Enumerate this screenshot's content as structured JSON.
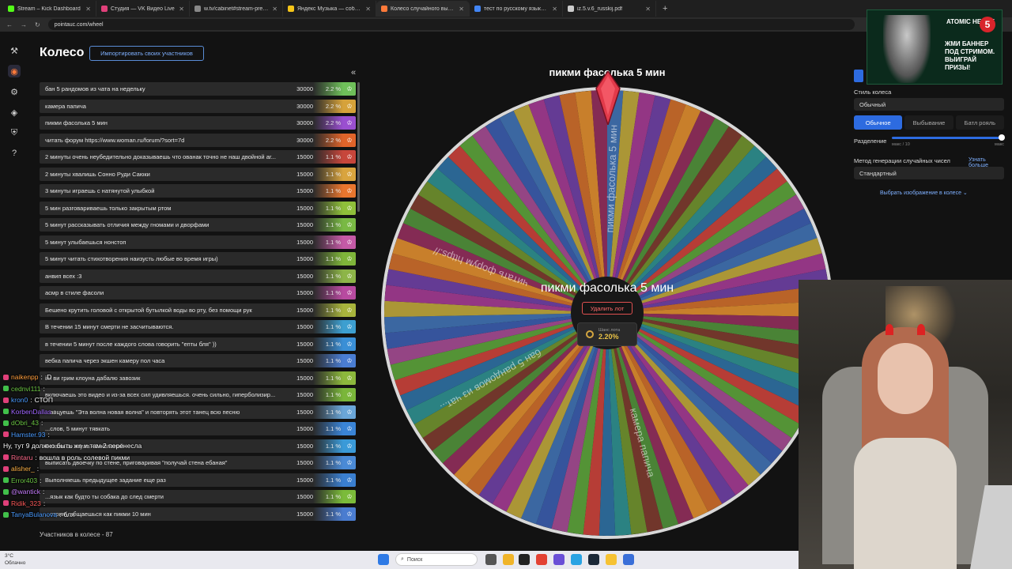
{
  "browser": {
    "tabs": [
      {
        "title": "Stream – Kick Dashboard",
        "color": "#53fc18"
      },
      {
        "title": "Студия — VK Видео Live",
        "color": "#e0407a"
      },
      {
        "title": "w.tv/cabinet#stream-preview",
        "color": "#888888"
      },
      {
        "title": "Яндекс Музыка — собираем музыку",
        "color": "#f5c518"
      },
      {
        "title": "Колесо случайного выбора",
        "color": "#ff7a3a"
      },
      {
        "title": "тест по русскому языку за 5 класс",
        "color": "#4285f4"
      },
      {
        "title": "iz.5.v.6_russkij.pdf",
        "color": "#cccccc"
      }
    ],
    "active_tab": 4,
    "new_tab": "+",
    "url": "pointauc.com/wheel"
  },
  "rail": {
    "icons": [
      "hammer-icon",
      "wheel-icon",
      "gear-icon",
      "layers-icon",
      "shield-icon",
      "help-icon"
    ],
    "glyphs": [
      "⚒",
      "◉",
      "⚙",
      "◈",
      "⛨",
      "?"
    ]
  },
  "header": {
    "title": "Колесо",
    "import_label": "Импортировать своих участников",
    "collapse": "«"
  },
  "lots": [
    {
      "name": "бан 5 рандомов из чата на недельку",
      "amount": "30000",
      "pct": "2.2 %",
      "color": "#6fbf5a"
    },
    {
      "name": "камера папича",
      "amount": "30000",
      "pct": "2.2 %",
      "color": "#d6a23a"
    },
    {
      "name": "пикми фасолька 5 мин",
      "amount": "30000",
      "pct": "2.2 %",
      "color": "#9a4fd0"
    },
    {
      "name": "читать форум https://www.woman.ru/forum/?sort=7d",
      "amount": "30000",
      "pct": "2.2 %",
      "color": "#e0642a"
    },
    {
      "name": "2 минуты очень неубедительно доказываешь что ованак точно не наш двойной аг...",
      "amount": "15000",
      "pct": "1.1 %",
      "color": "#c7463b"
    },
    {
      "name": "2 минуты хвалишь Сонно Руди Саюки",
      "amount": "15000",
      "pct": "1.1 %",
      "color": "#d9a43e"
    },
    {
      "name": "3 минуты играешь с натянутой улыбкой",
      "amount": "15000",
      "pct": "1.1 %",
      "color": "#e8762e"
    },
    {
      "name": "5 мин разговариваешь только закрытым ртом",
      "amount": "15000",
      "pct": "1.1 %",
      "color": "#8fbf3a"
    },
    {
      "name": "5 минут рассказывать отличия между гномами и дворфами",
      "amount": "15000",
      "pct": "1.1 %",
      "color": "#79b944"
    },
    {
      "name": "5 минут улыбаешься нонстоп",
      "amount": "15000",
      "pct": "1.1 %",
      "color": "#c55aa6"
    },
    {
      "name": "5 минут читать стихотворения наизусть любые во время игры)",
      "amount": "15000",
      "pct": "1.1 %",
      "color": "#7fb53a"
    },
    {
      "name": "анвип всех :3",
      "amount": "15000",
      "pct": "1.1 %",
      "color": "#8db548"
    },
    {
      "name": "асмр в стиле фасоли",
      "amount": "15000",
      "pct": "1.1 %",
      "color": "#b84aa0"
    },
    {
      "name": "Бешено крутить головой с открытой бутылкой воды во рту, без помощи рук",
      "amount": "15000",
      "pct": "1.1 %",
      "color": "#a8b43c"
    },
    {
      "name": "В течении 15 минут смерти не засчитываются.",
      "amount": "15000",
      "pct": "1.1 %",
      "color": "#3d9fd0"
    },
    {
      "name": "в течении 5 минут после каждого слова говорить \"епты бля\" ))",
      "amount": "15000",
      "pct": "1.1 %",
      "color": "#3a8fd6"
    },
    {
      "name": "вебка папича через экшен камеру пол часа",
      "amount": "15000",
      "pct": "1.1 %",
      "color": "#4a7dd2"
    },
    {
      "name": "ви ви грим клоуна дабалю завозик",
      "amount": "15000",
      "pct": "1.1 %",
      "color": "#8cb83c"
    },
    {
      "name": "включаешь это видео и из-за всех сил удивляешься. очень сильно, гиперболизир...",
      "amount": "15000",
      "pct": "1.1 %",
      "color": "#7ab63a"
    },
    {
      "name": "...анцуешь \"Эта волна новая волна\" и повторять этот танец всю песню",
      "amount": "15000",
      "pct": "1.1 %",
      "color": "#6aa6d8"
    },
    {
      "name": "...слов, 5 минут тявкать",
      "amount": "15000",
      "pct": "1.1 %",
      "color": "#3a84d6"
    },
    {
      "name": "Встала со стула +1 желаний",
      "amount": "15000",
      "pct": "1.1 %",
      "color": "#3a9ad8"
    },
    {
      "name": "выписать двоечку по стене, приговаривая \"получай стена ебаная\"",
      "amount": "15000",
      "pct": "1.1 %",
      "color": "#4a8ad6"
    },
    {
      "name": "Выполняешь предыдущее задание еще раз",
      "amount": "15000",
      "pct": "1.1 %",
      "color": "#3a7fd0"
    },
    {
      "name": "...язык как будто ты собака до след смерти",
      "amount": "15000",
      "pct": "1.1 %",
      "color": "#7bbb3a"
    },
    {
      "name": "...стрим, общаешься как пикми 10 мин",
      "amount": "15000",
      "pct": "1.1 %",
      "color": "#4a7cd0"
    }
  ],
  "footer": {
    "participants": "Участников в колесе - 87"
  },
  "wheel": {
    "title": "пикми фасолька 5 мин",
    "winner": "пикми фасолька 5 мин",
    "delete_label": "Удалить лот",
    "chance_label": "Шанс лота",
    "chance_value": "2.20%",
    "segment_count": 87,
    "segment_labels": [
      {
        "text": "пикми фасолька 5 мин"
      },
      {
        "text": "читать форум https://"
      },
      {
        "text": "бан 5 рандомов из чат..."
      },
      {
        "text": "камера папича"
      }
    ],
    "palette": [
      "#3f6fae",
      "#4f8d3a",
      "#a04a8e",
      "#d8892e",
      "#c4413a",
      "#6b3fa0",
      "#2e8c8c",
      "#b8a23a",
      "#7a3a2e",
      "#3a5aa8",
      "#8e2e5a",
      "#5a9e3a",
      "#c86a2a",
      "#2e6e9e",
      "#9e3a8e",
      "#6e8e2e"
    ]
  },
  "settings": {
    "wheel_style_label": "Стиль колеса",
    "wheel_style_value": "Обычный",
    "modes": [
      "Обычное",
      "Выбывание",
      "Батл рояль"
    ],
    "active_mode": 0,
    "division_label": "Разделение",
    "division_min": "макс / 10",
    "division_max": "макс",
    "division_level": 1.0,
    "rng_label": "Метод генерации случайных чисел",
    "rng_link": "Узнать больше",
    "rng_value": "Стандартный",
    "image_link": "Выбрать изображение в колесе"
  },
  "ad": {
    "brand": "ATOMIC HEART",
    "badge": "5",
    "text": "ЖМИ БАННЕР ПОД СТРИМОМ. ВЫИГРАЙ ПРИЗЫ!"
  },
  "chat": [
    {
      "user": "naikenpp",
      "msg": ":D",
      "color": "#ff9e3d",
      "badge": "live"
    },
    {
      "user": "cednvi111",
      "msg": "",
      "color": "#6cc644",
      "badge": "k"
    },
    {
      "user": "kron0",
      "msg": "СТОП",
      "color": "#4a9bff",
      "badge": "live"
    },
    {
      "user": "KorbenDallas",
      "msg": "",
      "color": "#a066ff",
      "badge": "k"
    },
    {
      "user": "dObri_43",
      "msg": "",
      "color": "#6cc644",
      "badge": "k"
    },
    {
      "user": "Hamster.93",
      "msg": "",
      "color": "#4a9bff",
      "badge": "live"
    },
    {
      "user": "",
      "msg": "Ну, тут 9 должно быть же и там 2 перенесла",
      "color": "#ffffff",
      "badge": "none"
    },
    {
      "user": "Rintaru",
      "msg": "вошла в роль солевой пикми",
      "color": "#ff6b8b",
      "badge": "live"
    },
    {
      "user": "alisher_",
      "msg": "",
      "color": "#ffb347",
      "badge": "live"
    },
    {
      "user": "Error403",
      "msg": "",
      "color": "#6cc644",
      "badge": "k"
    },
    {
      "user": "@wantick",
      "msg": "",
      "color": "#c77dff",
      "badge": "k"
    },
    {
      "user": "Ridik_323",
      "msg": "",
      "color": "#ff5a5a",
      "badge": "live"
    },
    {
      "user": "TanyaBulanova",
      "msg": "бля",
      "color": "#4a9bff",
      "badge": "k"
    }
  ],
  "taskbar": {
    "weather": "3°C",
    "weather_sub": "Облачно",
    "search": "Поиск"
  }
}
